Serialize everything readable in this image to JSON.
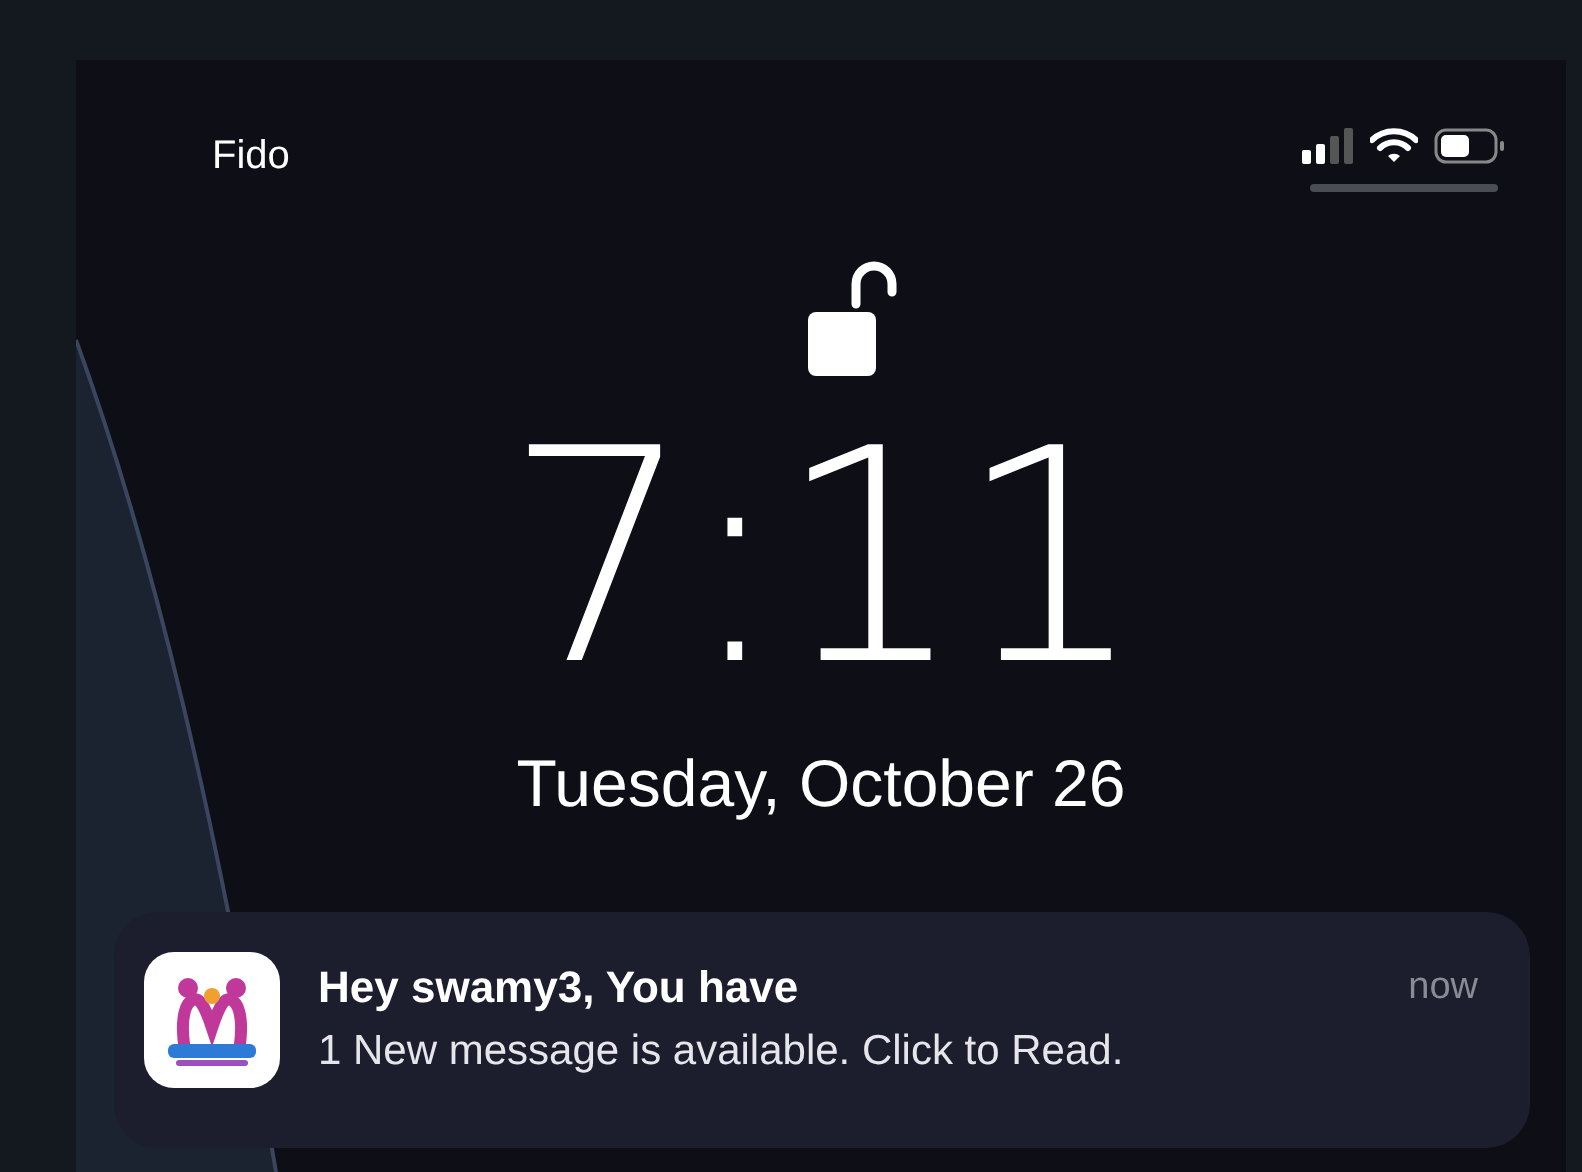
{
  "status_bar": {
    "carrier": "Fido"
  },
  "lock": {
    "unlocked": true
  },
  "clock": {
    "time": "7:11",
    "date": "Tuesday, October 26"
  },
  "notification": {
    "title": "Hey swamy3, You have",
    "body": "1 New message is available. Click to Read.",
    "time": "now"
  }
}
